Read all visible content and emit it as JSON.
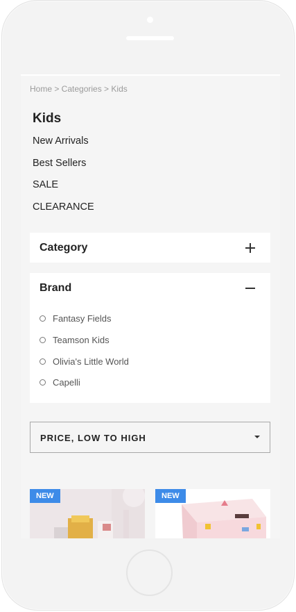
{
  "breadcrumb": "Home > Categories > Kids",
  "nav": {
    "title": "Kids",
    "links": [
      "New Arrivals",
      "Best Sellers",
      "SALE",
      "CLEARANCE"
    ]
  },
  "filters": {
    "category": {
      "title": "Category",
      "expanded": false,
      "icon": "plus-icon"
    },
    "brand": {
      "title": "Brand",
      "expanded": true,
      "icon": "minus-icon",
      "options": [
        "Fantasy Fields",
        "Teamson Kids",
        "Olivia's Little World",
        "Capelli"
      ]
    }
  },
  "sort": {
    "selected": "PRICE, LOW TO HIGH"
  },
  "products": [
    {
      "badge": "NEW"
    },
    {
      "badge": "NEW"
    }
  ],
  "colors": {
    "badge": "#3d8be8",
    "panel": "#ffffff",
    "background": "#f5f5f5"
  }
}
